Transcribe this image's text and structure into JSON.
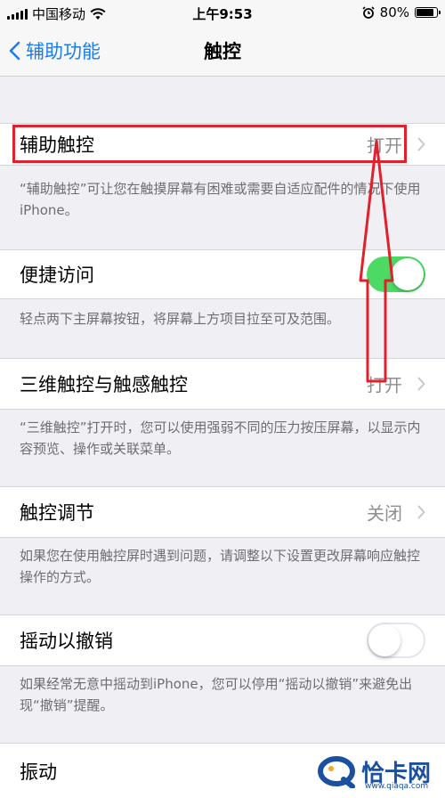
{
  "status_bar": {
    "carrier": "中国移动",
    "time": "上午9:53",
    "battery": "80%"
  },
  "nav": {
    "back_label": "辅助功能",
    "title": "触控"
  },
  "rows": {
    "assistive_touch": {
      "label": "辅助触控",
      "value": "打开"
    },
    "reachability": {
      "label": "便捷访问",
      "toggle_on": true
    },
    "touch_3d": {
      "label": "三维触控与触感触控",
      "value": "打开"
    },
    "touch_accommodations": {
      "label": "触控调节",
      "value": "关闭"
    },
    "shake_to_undo": {
      "label": "摇动以撤销",
      "toggle_on": false
    },
    "vibration": {
      "label": "振动"
    }
  },
  "notes": {
    "assistive_touch": "“辅助触控”可让您在触摸屏幕有困难或需要自适应配件的情况下使用iPhone。",
    "reachability": "轻点两下主屏幕按钮，将屏幕上方项目拉至可及范围。",
    "touch_3d": "“三维触控”打开时，您可以使用强弱不同的压力按压屏幕，以显示内容预览、操作或关联菜单。",
    "touch_accommodations": "如果您在使用触控屏时遇到问题，请调整以下设置更改屏幕响应触控操作的方式。",
    "shake_to_undo": "如果经常无意中摇动到iPhone，您可以停用“摇动以撤销”来避免出现“撤销”提醒。"
  },
  "watermark": {
    "text": "恰卡网",
    "sub": "www.qiaqa.com"
  },
  "colors": {
    "accent": "#1a7df3",
    "toggle_on": "#4cd964",
    "annotation": "#e0202a"
  }
}
